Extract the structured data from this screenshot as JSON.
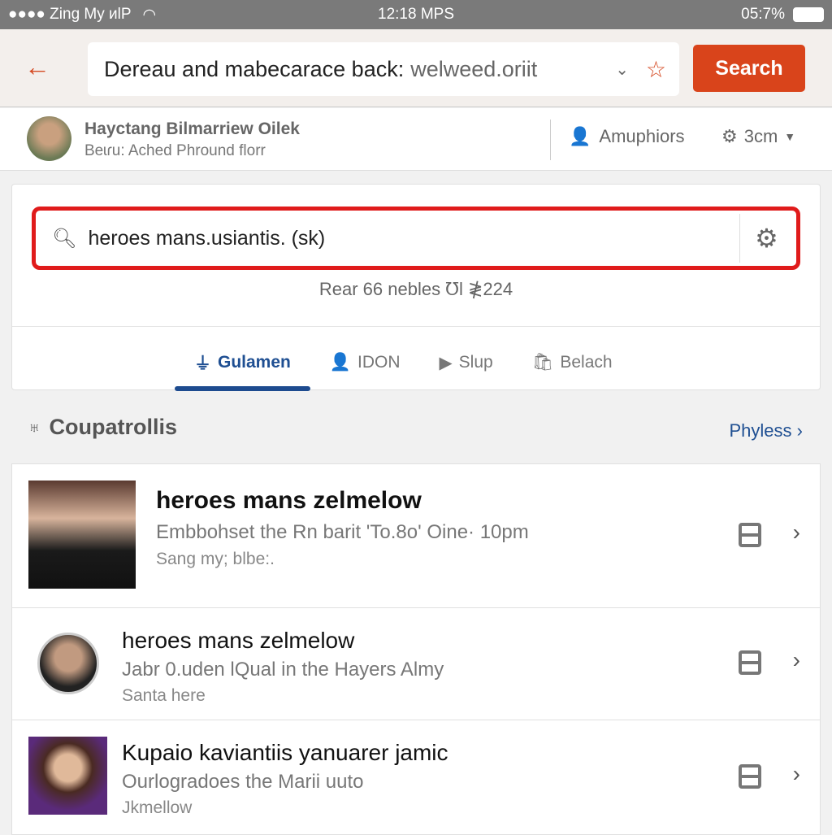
{
  "status_bar": {
    "carrier": "●●●● Zing My ᴎlP",
    "time": "12:18 MPS",
    "battery": "05:7%"
  },
  "top_bar": {
    "url_text": "Dereau and mabecarace back:",
    "url_domain": "welweed.oriit",
    "search_label": "Search"
  },
  "profile": {
    "name": "Hayctang Bilmarriew Oilek",
    "subtitle": "Beɩɾu: Ached Phround florr",
    "action_a": "Amuphiors",
    "action_b": "3cm"
  },
  "search": {
    "query": "heroes mans.usiantis. (sk)",
    "result_count": "Rear 66 nebles ℧l ≹224"
  },
  "tabs": [
    {
      "label": "Gulamen",
      "icon": "filter-icon",
      "active": true
    },
    {
      "label": "IDON",
      "icon": "person-icon"
    },
    {
      "label": "Slup",
      "icon": "play-icon"
    },
    {
      "label": "Belach",
      "icon": "bag-icon"
    }
  ],
  "section": {
    "title": "Coupatrollis",
    "more": "Phyless"
  },
  "results": [
    {
      "title": "heroes mans zelmelow",
      "subtitle": "Embbohset the Rn barit 'To.8o' Oine· 10pm",
      "meta": "Sang my; blbe:."
    },
    {
      "title": "heroes mans zelmelow",
      "subtitle": "Jabr 0.uden lQual in the Hayers Almy",
      "meta": "Santa here"
    },
    {
      "title": "Kupaio kaviantiis yanuarer jamic",
      "subtitle": "Ourlogradoes the Marii uuto",
      "meta": "Jkmellow"
    }
  ],
  "colors": {
    "accent": "#d9441b",
    "highlight": "#e01b1b",
    "tab_active": "#1d4b8f"
  }
}
